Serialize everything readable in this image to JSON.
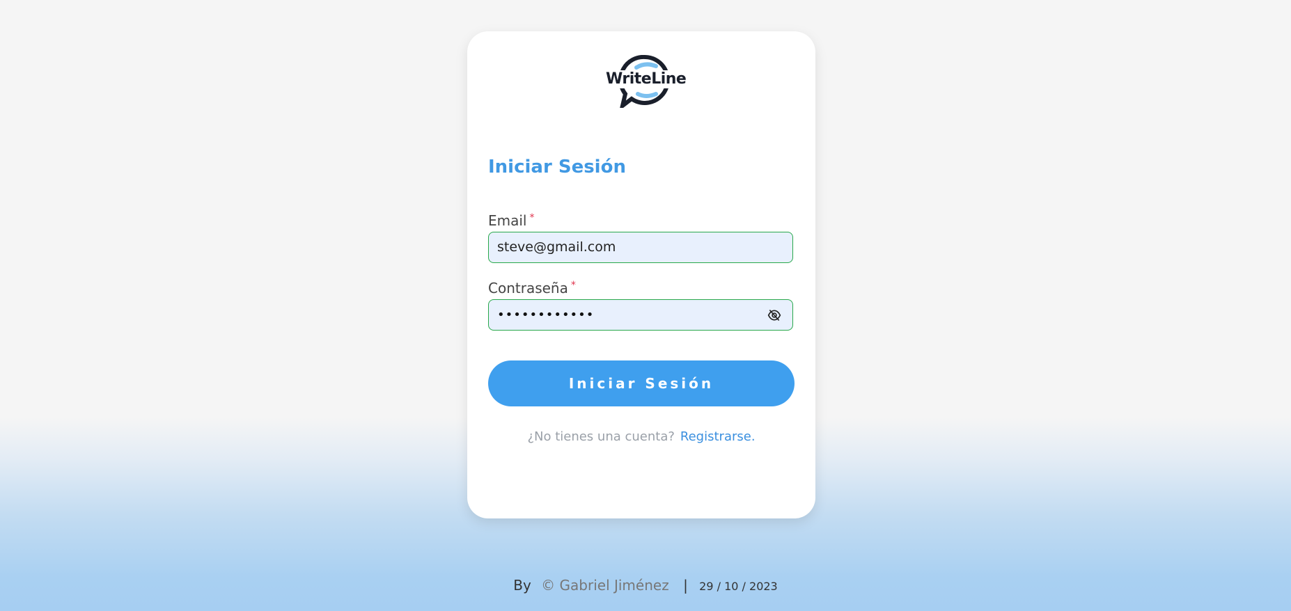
{
  "logo": {
    "text": "WriteLine"
  },
  "form": {
    "title": "Iniciar Sesión",
    "email_label": "Email",
    "email_value": "steve@gmail.com",
    "password_label": "Contraseña",
    "password_value": "••••••••••••",
    "required_mark": "*",
    "submit_label": "Iniciar Sesión"
  },
  "signup": {
    "prompt": "¿No tienes una cuenta?",
    "link_label": "Registrarse",
    "suffix": "."
  },
  "footer": {
    "by": "By",
    "author": "© Gabriel Jiménez",
    "separator": "|",
    "date": "29 / 10 / 2023"
  },
  "icons": {
    "password_toggle": "eye-off-icon"
  },
  "colors": {
    "accent": "#3f9fee",
    "title": "#4199e3",
    "link": "#3a8fdf",
    "input_bg": "#e8f0fd",
    "input_border": "#27a84a",
    "required": "#e0344d"
  }
}
